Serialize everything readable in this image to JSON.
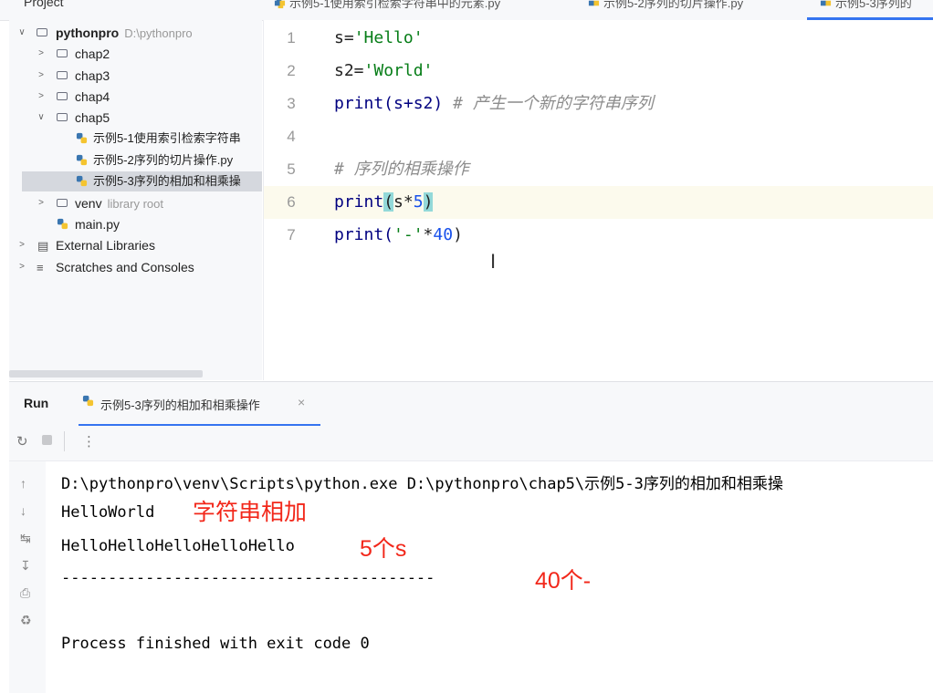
{
  "top": {
    "project_label": "Project",
    "tabs": [
      {
        "label": "示例5-1使用索引检索字符串中的元素.py",
        "active": false
      },
      {
        "label": "示例5-2序列的切片操作.py",
        "active": false
      },
      {
        "label": "示例5-3序列的",
        "active": true
      }
    ]
  },
  "tree": {
    "root": {
      "label": "pythonpro",
      "path": "D:\\pythonpro"
    },
    "folders": [
      "chap2",
      "chap3",
      "chap4",
      "chap5"
    ],
    "files": [
      "示例5-1使用索引检索字符串",
      "示例5-2序列的切片操作.py",
      "示例5-3序列的相加和相乘操"
    ],
    "venv": {
      "label": "venv",
      "hint": "library root"
    },
    "main": "main.py",
    "external": "External Libraries",
    "scratches": "Scratches and Consoles"
  },
  "editor": {
    "line_numbers": [
      "1",
      "2",
      "3",
      "4",
      "5",
      "6",
      "7"
    ],
    "lines": [
      {
        "var": "s=",
        "str": "'Hello'"
      },
      {
        "var": "s2=",
        "str": "'World'"
      },
      {
        "code": "print(s+s2)",
        "comment": "# 产生一个新的字符串序列"
      },
      {},
      {
        "comment": "# 序列的相乘操作"
      },
      {
        "fn": "print",
        "open": "(",
        "mid": "s*",
        "num": "5",
        "close": ")"
      },
      {
        "fn": "print(",
        "str": "'-'",
        "mid": "*",
        "num": "40",
        "close": ")"
      }
    ],
    "current_line": 6
  },
  "run": {
    "title": "Run",
    "tab_label": "示例5-3序列的相加和相乘操作",
    "close": "×"
  },
  "console": {
    "lines": [
      "D:\\pythonpro\\venv\\Scripts\\python.exe D:\\pythonpro\\chap5\\示例5-3序列的相加和相乘操",
      "HelloWorld",
      "HelloHelloHelloHelloHello",
      "----------------------------------------",
      "Process finished with exit code 0"
    ],
    "annotations": [
      "字符串相加",
      "5个s",
      "40个-"
    ]
  },
  "colors": {
    "accent": "#3574f0",
    "annotation": "#f2271a",
    "string": "#067d17",
    "number": "#1750eb",
    "comment": "#8c8c8c",
    "keyword": "#000080"
  },
  "icons": {
    "folder": "folder-icon",
    "python_file": "python-file-icon",
    "library": "library-icon",
    "scratches": "scratches-icon",
    "rerun": "rerun-icon",
    "stop": "stop-icon",
    "more": "more-icon",
    "up": "arrow-up-icon",
    "down": "arrow-down-icon",
    "wrap": "soft-wrap-icon",
    "scroll_end": "scroll-to-end-icon",
    "print": "print-icon",
    "trash": "trash-icon",
    "chevron_down": "chevron-down-icon",
    "chevron_right": "chevron-right-icon",
    "text_cursor": "text-cursor-icon"
  }
}
